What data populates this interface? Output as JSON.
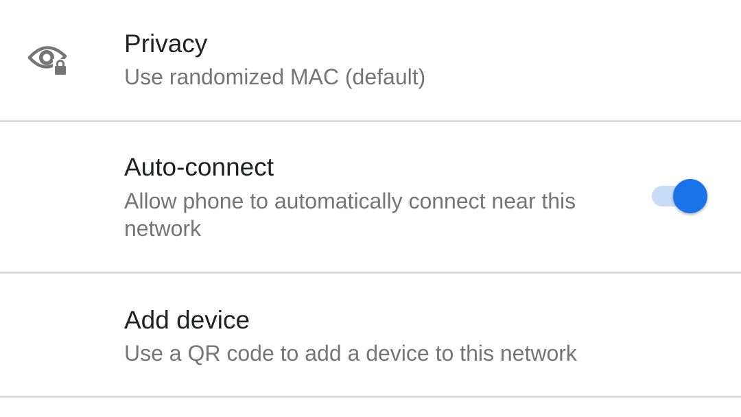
{
  "settings": {
    "privacy": {
      "icon": "privacy-eye-lock-icon",
      "title": "Privacy",
      "summary": "Use randomized MAC (default)"
    },
    "auto_connect": {
      "title": "Auto-connect",
      "summary": "Allow phone to automatically connect near this network",
      "toggle_on": true
    },
    "add_device": {
      "title": "Add device",
      "summary": "Use a QR code to add a device to this network"
    }
  },
  "colors": {
    "accent": "#1a73e8",
    "accent_track": "#c7dcf7",
    "title_text": "#202124",
    "summary_text": "#757575",
    "icon": "#757575",
    "divider": "#dcdcdc"
  }
}
